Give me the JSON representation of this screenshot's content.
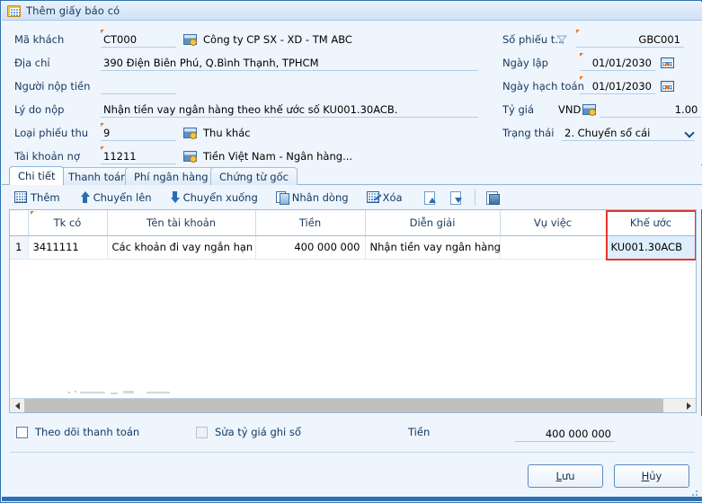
{
  "window": {
    "title": "Thêm giấy báo có",
    "icon": "window-grid-icon"
  },
  "form": {
    "left": [
      {
        "label": "Mã khách",
        "value": "CT000",
        "desc": "Công ty CP SX - XD - TM ABC",
        "lookup": true,
        "required": true
      },
      {
        "label": "Địa chỉ",
        "value": "390 Điện Biên Phú, Q.Bình Thạnh, TPHCM",
        "desc": "",
        "lookup": false,
        "required": false
      },
      {
        "label": "Người nộp tiền",
        "value": "",
        "desc": "",
        "lookup": false,
        "required": false
      },
      {
        "label": "Lý do nộp",
        "value": "Nhận tiền vay ngân hàng theo khế ước số KU001.30ACB.",
        "desc": "",
        "lookup": false,
        "required": false
      },
      {
        "label": "Loại phiếu thu",
        "value": "9",
        "desc": "Thu khác",
        "lookup": true,
        "required": true
      },
      {
        "label": "Tài khoản nợ",
        "value": "11211",
        "desc": "Tiền Việt Nam - Ngân hàng...",
        "lookup": true,
        "required": true
      }
    ],
    "right": {
      "so_phieu_label": "Số phiếu t...",
      "so_phieu_value": "GBC001",
      "ngay_lap_label": "Ngày lập",
      "ngay_lap_value": "01/01/2030",
      "ngay_hach_toan_label": "Ngày hạch toán",
      "ngay_hach_toan_value": "01/01/2030",
      "ty_gia_label": "Tỷ giá",
      "ty_gia_currency": "VND",
      "ty_gia_value": "1.00",
      "trang_thai_label": "Trạng thái",
      "trang_thai_value": "2. Chuyển sổ cái"
    }
  },
  "tabs": [
    {
      "label": "Chi tiết",
      "active": true
    },
    {
      "label": "Thanh toán",
      "active": false
    },
    {
      "label": "Phí ngân hàng",
      "active": false
    },
    {
      "label": "Chứng từ gốc",
      "active": false
    }
  ],
  "grid_toolbar": [
    {
      "label": "Thêm",
      "icon": "add-row-icon"
    },
    {
      "label": "Chuyển lên",
      "icon": "arrow-up-icon"
    },
    {
      "label": "Chuyển xuống",
      "icon": "arrow-down-icon"
    },
    {
      "label": "Nhân dòng",
      "icon": "duplicate-row-icon"
    },
    {
      "label": "Xóa",
      "icon": "delete-row-icon"
    },
    {
      "label": "",
      "icon": "page-up-icon"
    },
    {
      "label": "",
      "icon": "page-down-icon"
    },
    {
      "label": "",
      "icon": "save-layout-icon"
    }
  ],
  "grid": {
    "columns": [
      {
        "key": "rownum",
        "label": ""
      },
      {
        "key": "tk_co",
        "label": "Tk có",
        "required": true
      },
      {
        "key": "ten_tai_khoan",
        "label": "Tên tài khoản"
      },
      {
        "key": "tien",
        "label": "Tiền"
      },
      {
        "key": "dien_giai",
        "label": "Diễn giải"
      },
      {
        "key": "vu_viec",
        "label": "Vụ việc"
      },
      {
        "key": "khe_uoc",
        "label": "Khế ước",
        "highlight": true
      }
    ],
    "rows": [
      {
        "rownum": "1",
        "tk_co": "3411111",
        "ten_tai_khoan": "Các khoản đi vay ngắn hạn",
        "tien": "400 000 000",
        "dien_giai": "Nhận tiền vay ngân hàng",
        "vu_viec": "",
        "khe_uoc": "KU001.30ACB"
      }
    ]
  },
  "bottom": {
    "checkbox_theo_doi": "Theo dõi thanh toán",
    "checkbox_sua_ty_gia": "Sửa tỷ giá ghi sổ",
    "tien_label": "Tiền",
    "tien_value": "400 000 000",
    "save_button": "Lưu",
    "cancel_button": "Hủy"
  },
  "colors": {
    "window_border": "#2f6fb5",
    "panel_bg": "#eef5fd",
    "highlight_red": "#e8342a",
    "cell_highlight": "#ddeeff",
    "required_marker": "#e8761b"
  }
}
